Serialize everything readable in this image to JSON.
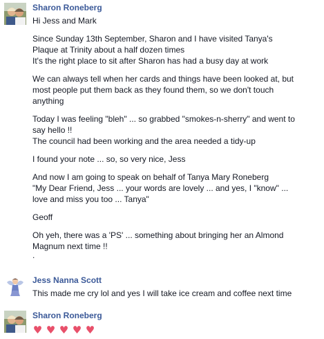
{
  "comments": [
    {
      "author": "Sharon Roneberg",
      "avatar": "avatar-photo-couple",
      "paragraphs": [
        [
          "Hi Jess and Mark"
        ],
        [
          "Since Sunday 13th September, Sharon and I have visited Tanya's",
          "Plaque at Trinity about a half dozen times",
          "It's the right place to sit after Sharon has had a busy day at work"
        ],
        [
          "We can always tell when her cards and things have been looked at, but",
          "most people put them back as they found them, so we don't touch",
          "anything"
        ],
        [
          "Today I was feeling \"bleh\" ... so grabbed \"smokes-n-sherry\" and went to",
          "say hello !!",
          "The council had been working and the area needed a tidy-up"
        ],
        [
          "I found your note ... so, so very nice, Jess"
        ],
        [
          "And now I am going to speak on behalf of Tanya Mary Roneberg",
          "\"My Dear Friend, Jess ... your words are lovely ... and yes, I \"know\" ...",
          "love and miss you too ... Tanya\""
        ],
        [
          "Geoff"
        ],
        [
          "Oh yeh, there was a 'PS' ... something about bringing her an Almond",
          "Magnum next time !!",
          "."
        ]
      ]
    },
    {
      "author": "Jess Nanna Scott",
      "avatar": "avatar-fairy",
      "paragraphs": [
        [
          "This made me cry lol and yes I will take ice cream and coffee next time"
        ]
      ]
    },
    {
      "author": "Sharon Roneberg",
      "avatar": "avatar-photo-couple",
      "hearts": [
        "♥",
        "♥",
        "♥",
        "♥",
        "♥"
      ]
    }
  ],
  "colors": {
    "author_link": "#3b5998",
    "text": "#141823",
    "heart": "#e8506a"
  }
}
